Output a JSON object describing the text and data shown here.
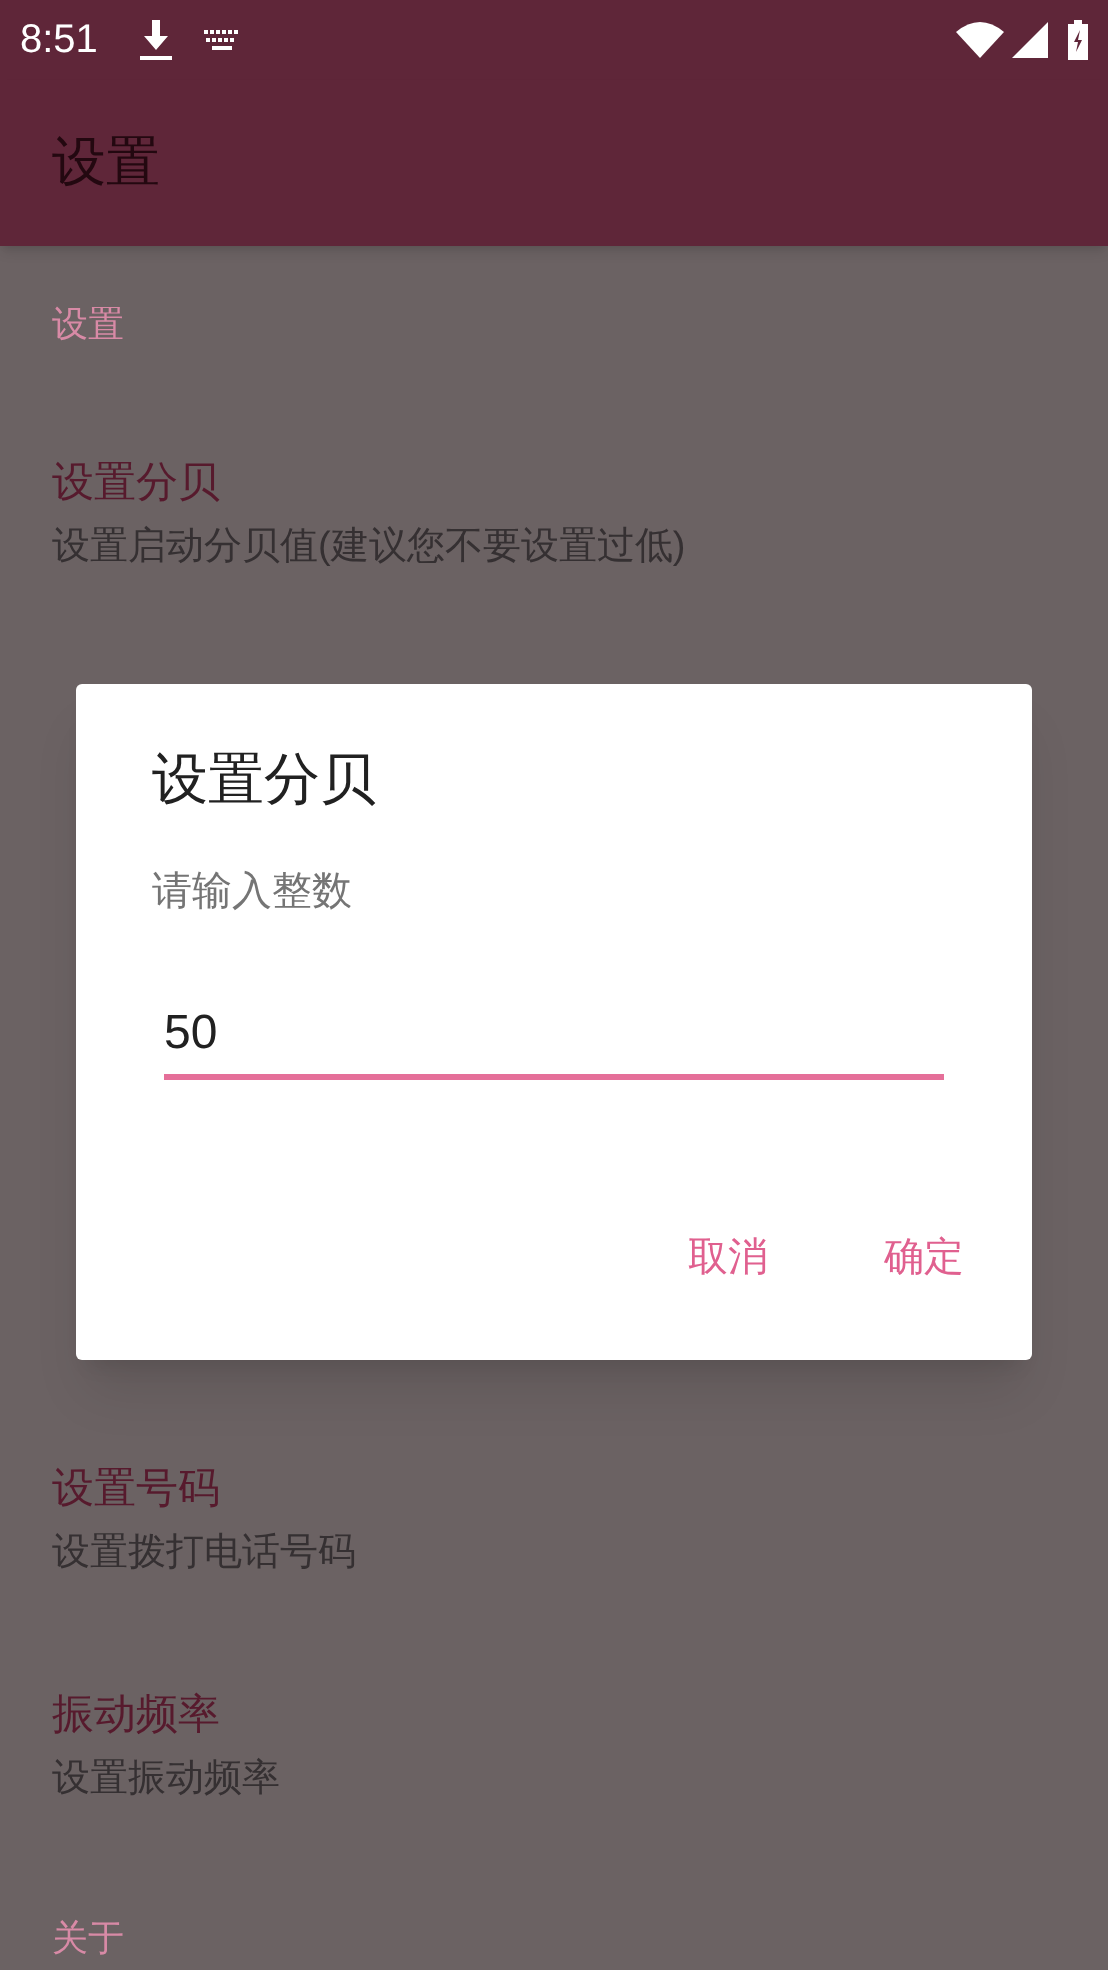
{
  "status_bar": {
    "time": "8:51"
  },
  "app_bar": {
    "title": "设置"
  },
  "sections": [
    {
      "header": "设置",
      "items": [
        {
          "title": "设置分贝",
          "summary": "设置启动分贝值(建议您不要设置过低)"
        }
      ]
    },
    {
      "items": [
        {
          "title": "设置号码",
          "summary": "设置拨打电话号码"
        },
        {
          "title": "振动频率",
          "summary": "设置振动频率"
        }
      ]
    },
    {
      "header": "关于"
    }
  ],
  "dialog": {
    "title": "设置分贝",
    "message": "请输入整数",
    "value": "50",
    "buttons": [
      "取消",
      "确定"
    ]
  }
}
